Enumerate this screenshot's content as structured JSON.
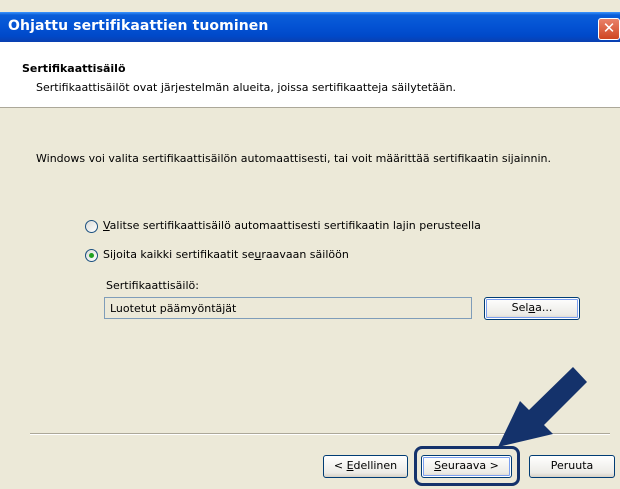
{
  "window": {
    "title": "Ohjattu sertifikaattien tuominen",
    "close": "✕"
  },
  "header": {
    "title": "Sertifikaattisäilö",
    "subtitle": "Sertifikaattisäilöt ovat järjestelmän alueita, joissa sertifikaatteja säilytetään."
  },
  "body": {
    "description": "Windows voi valita sertifikaattisäilön automaattisesti, tai voit määrittää sertifikaatin sijainnin.",
    "radio_auto": {
      "label_pre": "",
      "label_key": "V",
      "label_post": "alitse sertifikaattisäilö automaattisesti sertifikaatin lajin perusteella",
      "selected": false
    },
    "radio_manual": {
      "label_pre": "Sijoita kaikki sertifikaatit se",
      "label_key": "u",
      "label_post": "raavaan säilöön",
      "selected": true
    },
    "store_label": "Sertifikaattisäilö:",
    "store_value": "Luotetut päämyöntäjät",
    "browse": {
      "pre": "Sel",
      "key": "a",
      "post": "a..."
    }
  },
  "footer": {
    "back": {
      "pre": "< ",
      "key": "E",
      "post": "dellinen"
    },
    "next": {
      "pre": "",
      "key": "S",
      "post": "euraava >"
    },
    "cancel": "Peruuta"
  },
  "colors": {
    "titlebar": "#0453d4",
    "annotation": "#14326b",
    "radio_dot": "#21a121"
  }
}
